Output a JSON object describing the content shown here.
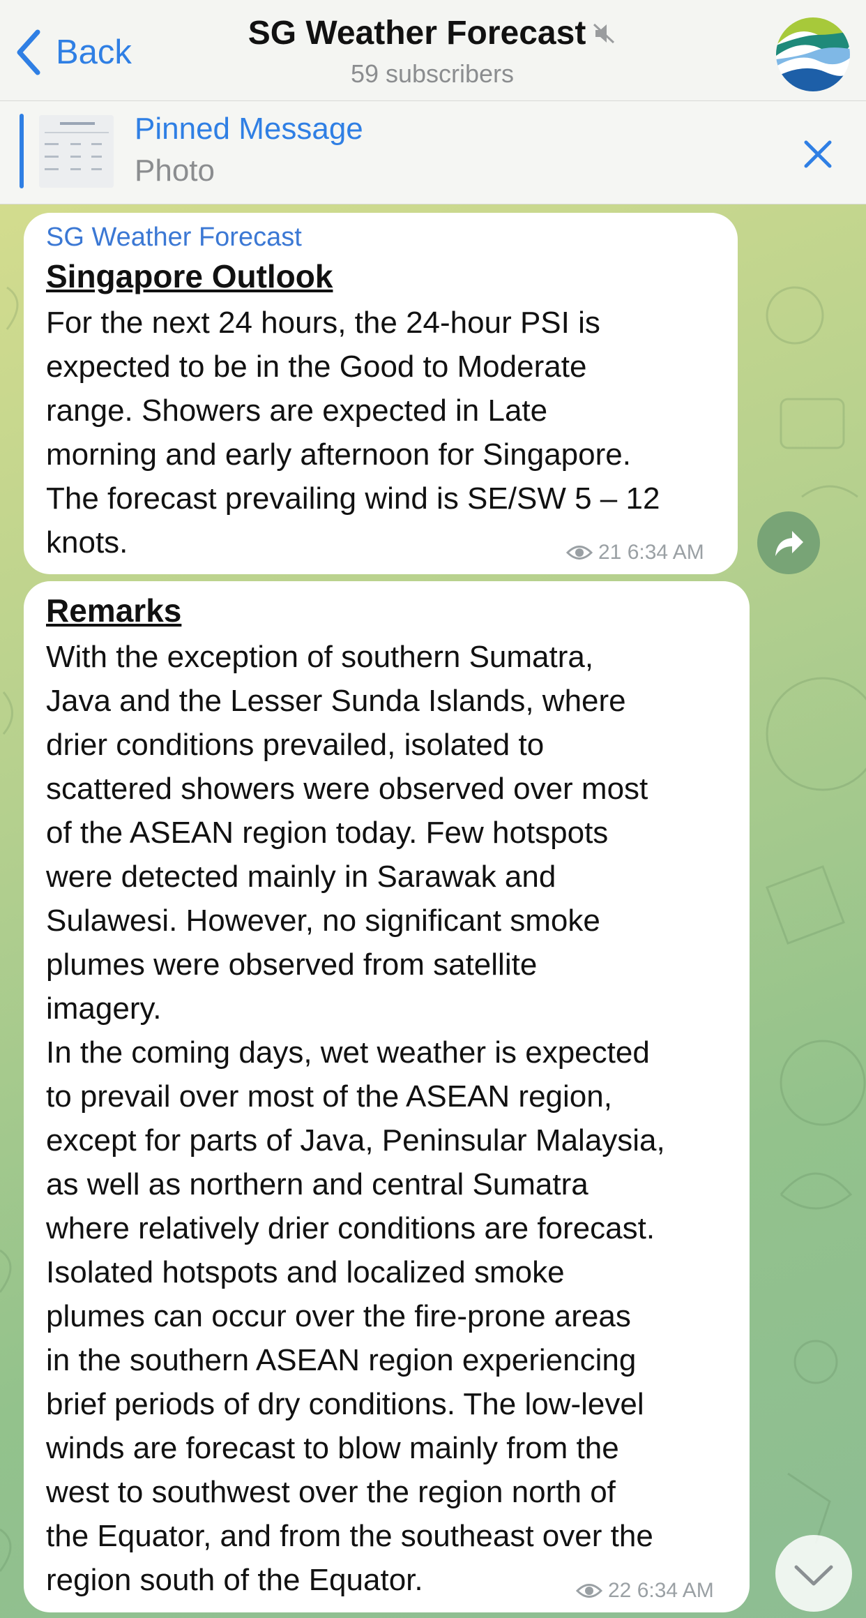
{
  "header": {
    "back_label": "Back",
    "title": "SG Weather Forecast",
    "subscribers": "59 subscribers",
    "mute_icon": "speaker-muted-icon"
  },
  "pinned": {
    "title": "Pinned Message",
    "subtitle": "Photo"
  },
  "messages": [
    {
      "sender": "SG Weather Forecast",
      "heading": "Singapore Outlook",
      "text": "For the next 24 hours, the 24-hour PSI is\nexpected to be in the Good to Moderate\nrange. Showers are expected in Late\nmorning and early afternoon for Singapore.\nThe forecast prevailing wind is SE/SW 5 – 12\nknots.",
      "views": "21",
      "time": "6:34 AM"
    },
    {
      "heading": "Remarks",
      "text": "With the exception of southern Sumatra,\nJava and the Lesser Sunda Islands, where\ndrier conditions prevailed, isolated to\nscattered showers were observed over most\nof the ASEAN region today. Few hotspots\nwere detected mainly in Sarawak and\nSulawesi. However, no significant smoke\nplumes were observed from satellite\nimagery.\nIn the coming days, wet weather is expected\nto prevail over most of the ASEAN region,\nexcept for parts of Java, Peninsular Malaysia,\nas well as northern and central Sumatra\nwhere relatively drier conditions are forecast.\nIsolated hotspots and localized smoke\nplumes can occur over the fire-prone areas\nin the southern ASEAN region experiencing\nbrief periods of dry conditions. The low-level\nwinds are forecast to blow mainly from the\nwest to southwest over the region north of\nthe Equator, and from the southeast over the\nregion south of the Equator.",
      "views": "22",
      "time": "6:34 AM"
    }
  ],
  "colors": {
    "accent": "#2f7fe4",
    "sender": "#3b78d4",
    "meta": "#9aa0a4"
  }
}
